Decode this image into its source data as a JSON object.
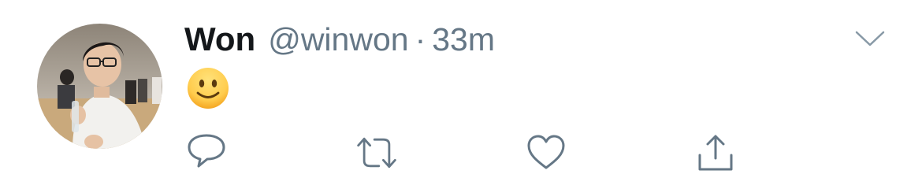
{
  "tweet": {
    "display_name": "Won",
    "handle": "@winwon",
    "separator": "·",
    "time": "33m",
    "text": "🙂"
  },
  "icons": {
    "caret": "chevron-down-icon",
    "reply": "reply-icon",
    "retweet": "retweet-icon",
    "like": "heart-icon",
    "share": "share-icon"
  },
  "colors": {
    "name": "#14171a",
    "secondary": "#657786",
    "icon": "#657786",
    "emoji_face": "#ffcc4d"
  }
}
